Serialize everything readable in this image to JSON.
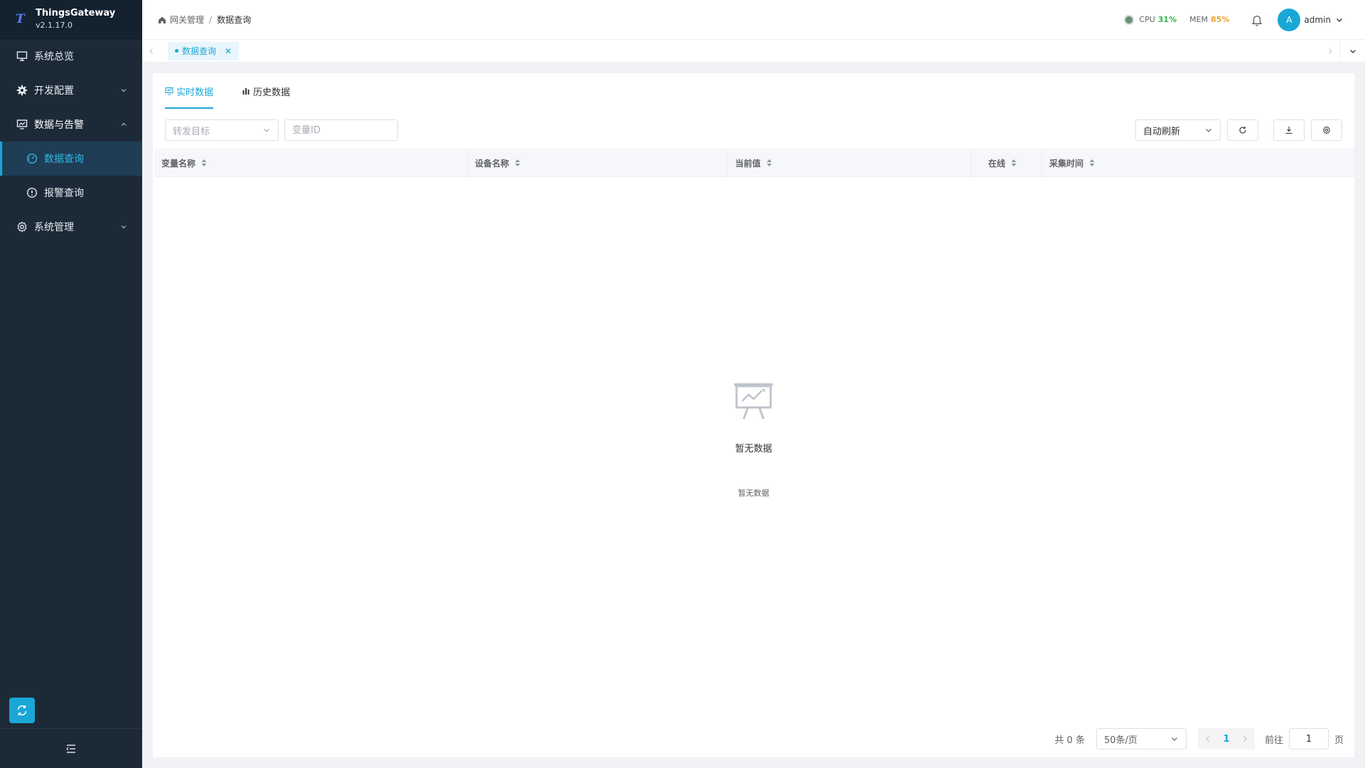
{
  "brand": {
    "name": "ThingsGateway",
    "version": "v2.1.17.0",
    "logo": "T",
    "accent": "#1aa7d6"
  },
  "sidebar": {
    "items": [
      {
        "label": "系统总览",
        "icon": "monitor-icon"
      },
      {
        "label": "开发配置",
        "icon": "gear-icon"
      },
      {
        "label": "数据与告警",
        "icon": "dashboard-icon",
        "expanded": true,
        "children": [
          {
            "label": "数据查询",
            "icon": "gauge-icon",
            "active": true
          },
          {
            "label": "报警查询",
            "icon": "warning-circle-icon"
          }
        ]
      },
      {
        "label": "系统管理",
        "icon": "settings-icon"
      }
    ]
  },
  "header": {
    "breadcrumb": [
      "网关管理",
      "数据查询"
    ],
    "cpu_label": "CPU",
    "cpu_value": "31%",
    "mem_label": "MEM",
    "mem_value": "85%",
    "avatar_letter": "A",
    "user": "admin"
  },
  "page_tabs": [
    {
      "label": "数据查询",
      "closable": true
    }
  ],
  "content_tabs": [
    {
      "label": "实时数据",
      "active": true
    },
    {
      "label": "历史数据"
    }
  ],
  "filters": {
    "target_placeholder": "转发目标",
    "variable_id_placeholder": "变量ID",
    "auto_refresh": "自动刷新"
  },
  "table": {
    "columns": [
      "变量名称",
      "设备名称",
      "当前值",
      "在线",
      "采集时间"
    ],
    "rows": [],
    "empty_title": "暂无数据",
    "empty_subtitle": "暂无数据"
  },
  "pagination": {
    "total_text": "共 0 条",
    "page_size": "50条/页",
    "current_page": "1",
    "goto_label": "前往",
    "goto_value": "1",
    "page_suffix": "页"
  }
}
